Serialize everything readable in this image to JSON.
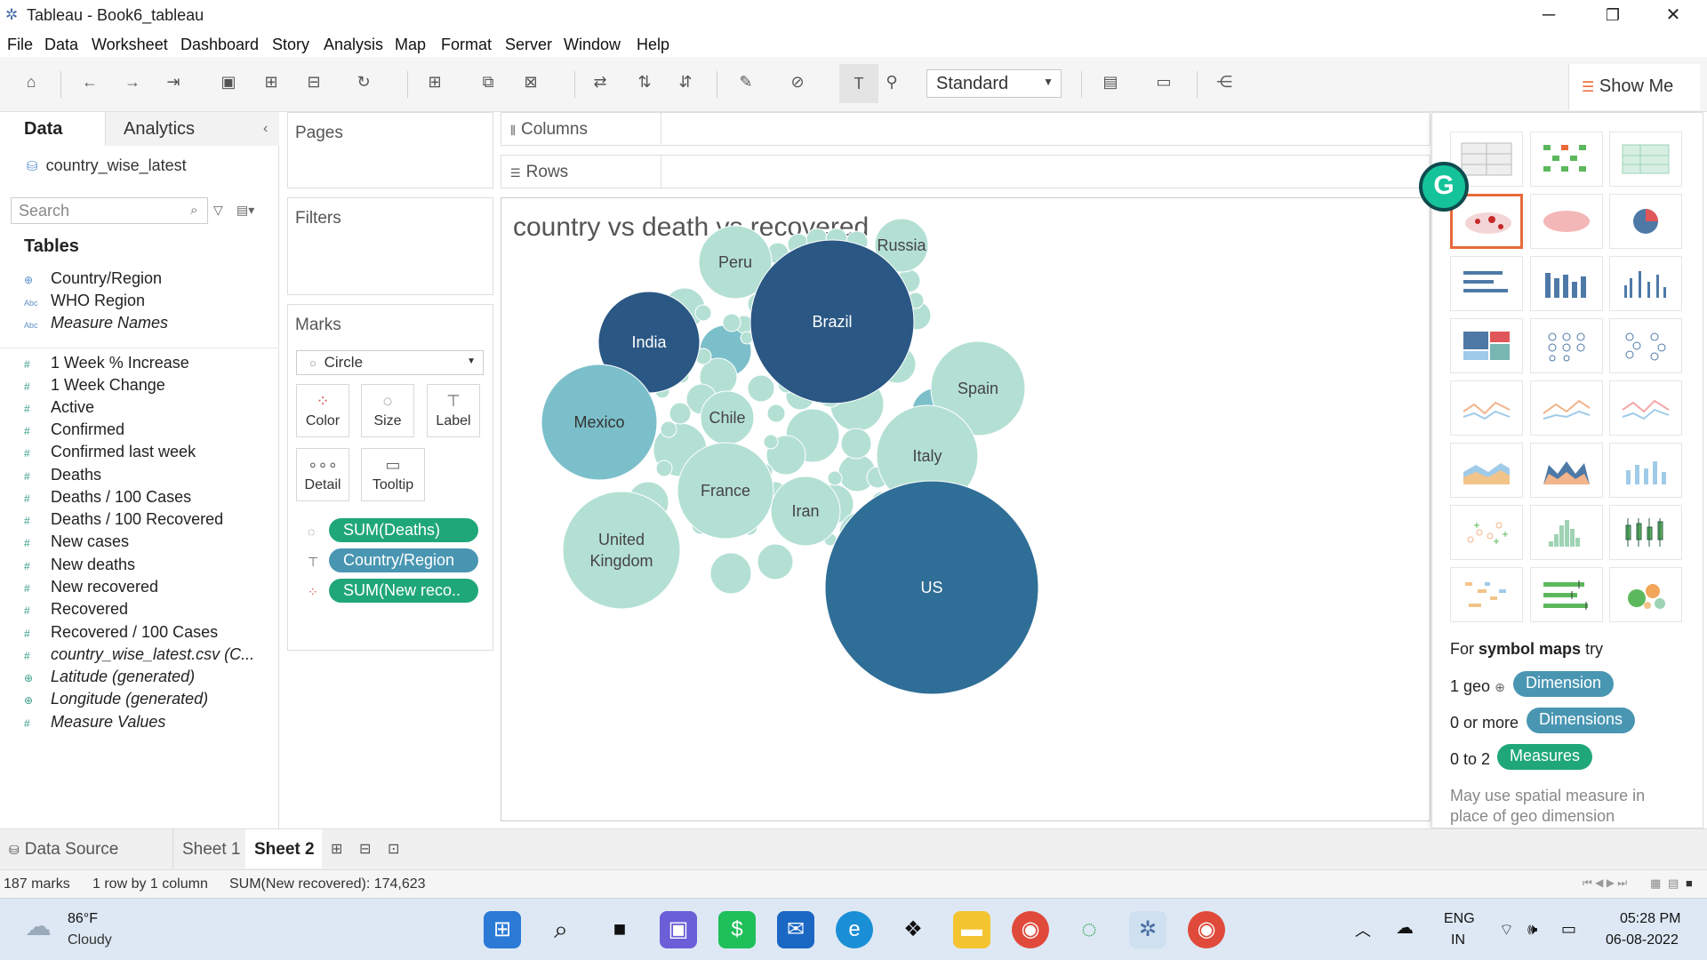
{
  "window": {
    "title": "Tableau - Book6_tableau",
    "minimize": "─",
    "restore": "❐",
    "close": "✕"
  },
  "menu": [
    "File",
    "Data",
    "Worksheet",
    "Dashboard",
    "Story",
    "Analysis",
    "Map",
    "Format",
    "Server",
    "Window",
    "Help"
  ],
  "toolbar": {
    "view_mode": "Standard",
    "show_me_label": "Show Me"
  },
  "data_pane": {
    "tab_data": "Data",
    "tab_analytics": "Analytics",
    "datasource": "country_wise_latest",
    "search_placeholder": "Search",
    "tables_heading": "Tables",
    "dimensions": [
      {
        "icon": "⊕",
        "label": "Country/Region"
      },
      {
        "icon": "Abc",
        "label": "WHO Region"
      },
      {
        "icon": "Abc",
        "label": "Measure Names"
      }
    ],
    "measures": [
      "1 Week % Increase",
      "1 Week Change",
      "Active",
      "Confirmed",
      "Confirmed last week",
      "Deaths",
      "Deaths / 100 Cases",
      "Deaths / 100 Recovered",
      "New cases",
      "New deaths",
      "New recovered",
      "Recovered",
      "Recovered / 100 Cases"
    ],
    "generated": [
      {
        "icon": "#",
        "label": "country_wise_latest.csv (C..."
      },
      {
        "icon": "⊕",
        "label": "Latitude (generated)"
      },
      {
        "icon": "⊕",
        "label": "Longitude (generated)"
      },
      {
        "icon": "#",
        "label": "Measure Values"
      }
    ]
  },
  "cards": {
    "pages": "Pages",
    "filters": "Filters",
    "marks": "Marks",
    "mark_type": "Circle",
    "mark_buttons": [
      "Color",
      "Size",
      "Label",
      "Detail",
      "Tooltip"
    ],
    "pills": [
      "SUM(Deaths)",
      "Country/Region",
      "SUM(New reco.."
    ]
  },
  "shelves": {
    "columns": "Columns",
    "rows": "Rows"
  },
  "viz": {
    "title": "country vs death vs recovered",
    "labeled_bubbles": [
      "Russia",
      "Peru",
      "Brazil",
      "India",
      "Spain",
      "Mexico",
      "Chile",
      "Italy",
      "France",
      "Iran",
      "United Kingdom",
      "US"
    ]
  },
  "colors": {
    "green_pill": "#20a779",
    "blue_pill": "#4996b2",
    "bubble_dark": "#2a5783",
    "bubble_mid": "#2f6e96",
    "bubble_teal": "#7bbfca",
    "bubble_light": "#b4e0d4"
  },
  "show_me": {
    "hint_prefix": "For ",
    "hint_bold": "symbol maps",
    "hint_suffix": " try",
    "row1_label": "1 geo",
    "row1_pill": "Dimension",
    "row2_label": "0 or more",
    "row2_pill": "Dimensions",
    "row3_label": "0 to 2",
    "row3_pill": "Measures",
    "note": "May use spatial measure in place of geo dimension"
  },
  "sheet_tabs": {
    "data_source": "Data Source",
    "sheet1": "Sheet 1",
    "sheet2": "Sheet 2"
  },
  "status": {
    "marks": "187 marks",
    "layout": "1 row by 1 column",
    "sum": "SUM(New recovered): 174,623"
  },
  "taskbar": {
    "weather_temp": "86°F",
    "weather_desc": "Cloudy",
    "lang": "ENG",
    "region": "IN",
    "time": "05:28 PM",
    "date": "06-08-2022"
  }
}
